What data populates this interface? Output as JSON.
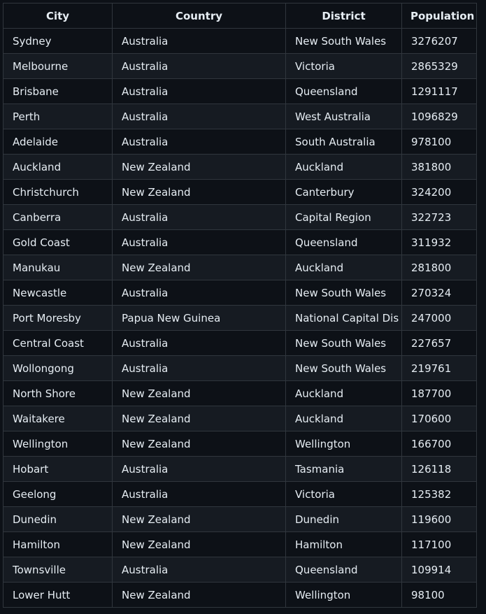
{
  "table": {
    "headers": [
      "City",
      "Country",
      "District",
      "Population"
    ],
    "rows": [
      [
        "Sydney",
        "Australia",
        "New South Wales",
        "3276207"
      ],
      [
        "Melbourne",
        "Australia",
        "Victoria",
        "2865329"
      ],
      [
        "Brisbane",
        "Australia",
        "Queensland",
        "1291117"
      ],
      [
        "Perth",
        "Australia",
        "West Australia",
        "1096829"
      ],
      [
        "Adelaide",
        "Australia",
        "South Australia",
        "978100"
      ],
      [
        "Auckland",
        "New Zealand",
        "Auckland",
        "381800"
      ],
      [
        "Christchurch",
        "New Zealand",
        "Canterbury",
        "324200"
      ],
      [
        "Canberra",
        "Australia",
        "Capital Region",
        "322723"
      ],
      [
        "Gold Coast",
        "Australia",
        "Queensland",
        "311932"
      ],
      [
        "Manukau",
        "New Zealand",
        "Auckland",
        "281800"
      ],
      [
        "Newcastle",
        "Australia",
        "New South Wales",
        "270324"
      ],
      [
        "Port Moresby",
        "Papua New Guinea",
        "National Capital Dis",
        "247000"
      ],
      [
        "Central Coast",
        "Australia",
        "New South Wales",
        "227657"
      ],
      [
        "Wollongong",
        "Australia",
        "New South Wales",
        "219761"
      ],
      [
        "North Shore",
        "New Zealand",
        "Auckland",
        "187700"
      ],
      [
        "Waitakere",
        "New Zealand",
        "Auckland",
        "170600"
      ],
      [
        "Wellington",
        "New Zealand",
        "Wellington",
        "166700"
      ],
      [
        "Hobart",
        "Australia",
        "Tasmania",
        "126118"
      ],
      [
        "Geelong",
        "Australia",
        "Victoria",
        "125382"
      ],
      [
        "Dunedin",
        "New Zealand",
        "Dunedin",
        "119600"
      ],
      [
        "Hamilton",
        "New Zealand",
        "Hamilton",
        "117100"
      ],
      [
        "Townsville",
        "Australia",
        "Queensland",
        "109914"
      ],
      [
        "Lower Hutt",
        "New Zealand",
        "Wellington",
        "98100"
      ]
    ]
  }
}
